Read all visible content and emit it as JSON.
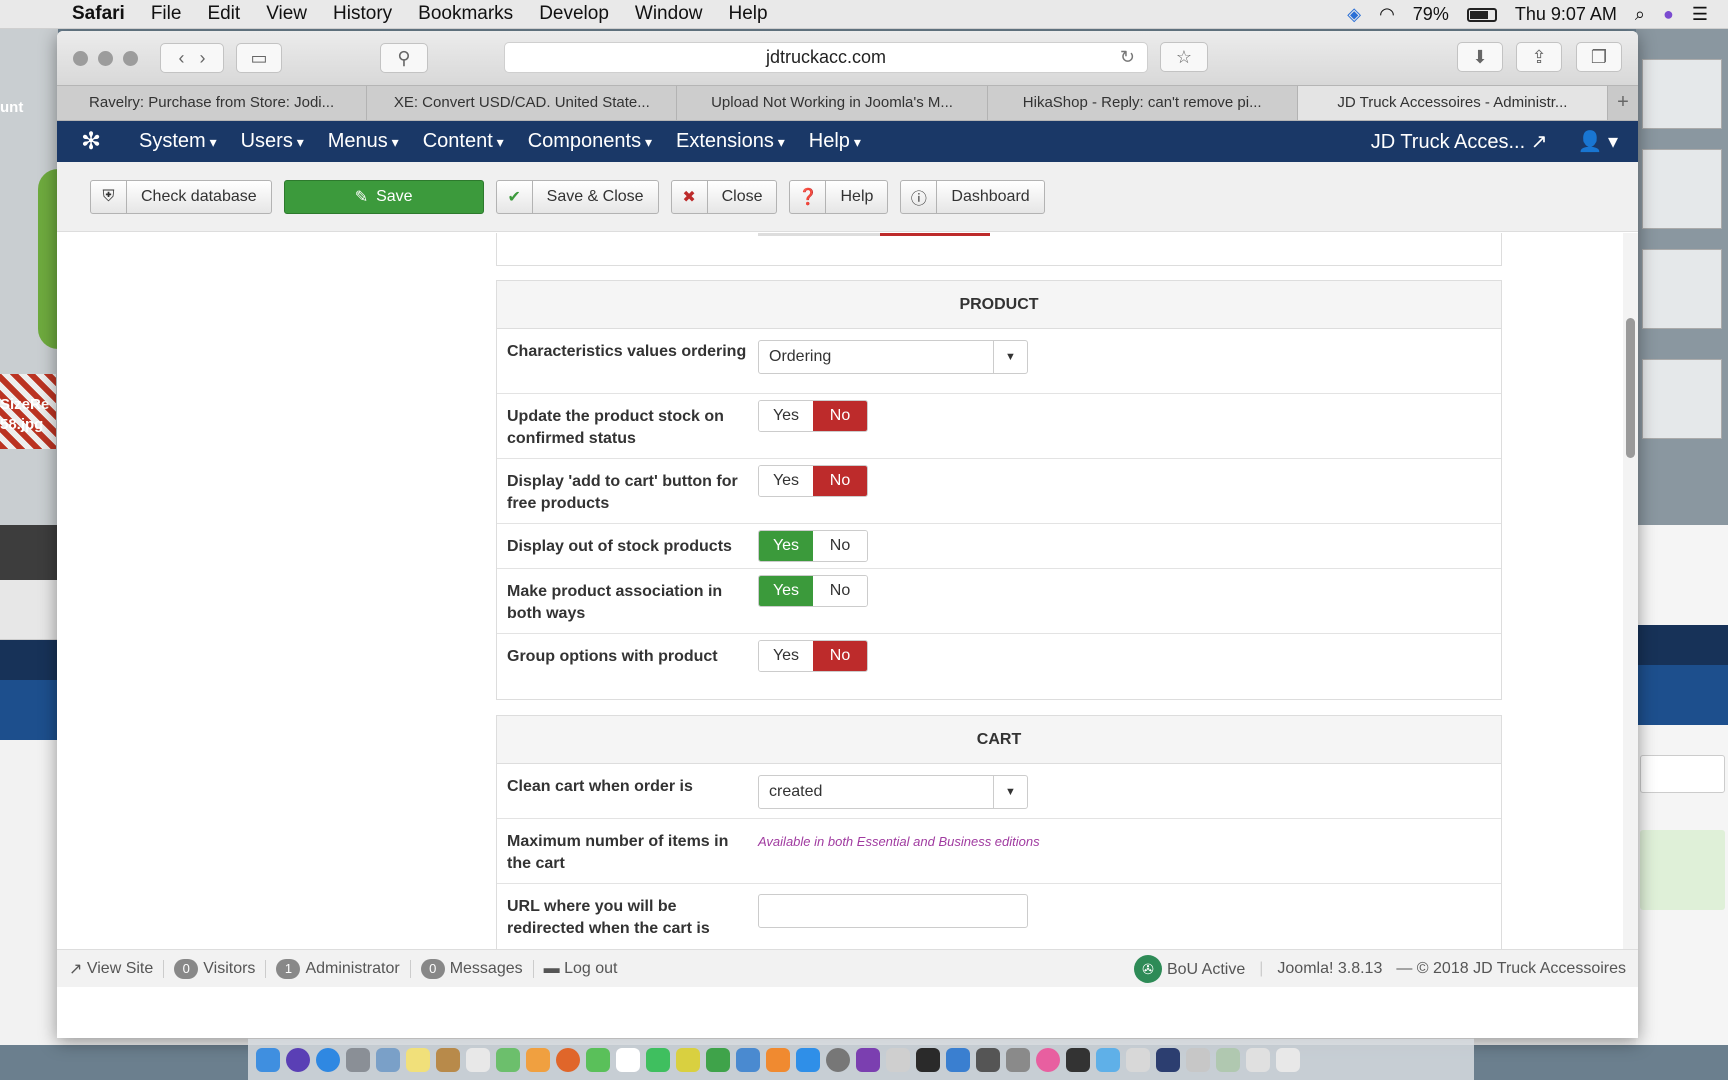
{
  "mac_menubar": {
    "app": "Safari",
    "items": [
      "File",
      "Edit",
      "View",
      "History",
      "Bookmarks",
      "Develop",
      "Window",
      "Help"
    ],
    "battery": "79%",
    "clock": "Thu 9:07 AM"
  },
  "desktop": {
    "labels": [
      "unt",
      "SizeRe",
      "58.jpg"
    ]
  },
  "browser": {
    "url": "jdtruckacc.com",
    "tabs": [
      "Ravelry: Purchase from Store: Jodi...",
      "XE: Convert USD/CAD. United State...",
      "Upload Not Working in Joomla's M...",
      "HikaShop - Reply: can't remove pi...",
      "JD Truck Accessoires - Administr..."
    ],
    "active_tab": 4
  },
  "joomla_nav": {
    "menus": [
      "System",
      "Users",
      "Menus",
      "Content",
      "Components",
      "Extensions",
      "Help"
    ],
    "site_name": "JD Truck Acces..."
  },
  "toolbar": {
    "check_database": "Check database",
    "save": "Save",
    "save_close": "Save & Close",
    "close": "Close",
    "help": "Help",
    "dashboard": "Dashboard"
  },
  "product_section": {
    "title": "PRODUCT",
    "yes_label": "Yes",
    "no_label": "No",
    "characteristics_label": "Characteristics values ordering",
    "characteristics_value": "Ordering",
    "rows": [
      {
        "label": "Update the product stock on confirmed status",
        "value": "No"
      },
      {
        "label": "Display 'add to cart' button for free products",
        "value": "No"
      },
      {
        "label": "Display out of stock products",
        "value": "Yes"
      },
      {
        "label": "Make product association in both ways",
        "value": "Yes"
      },
      {
        "label": "Group options with product",
        "value": "No"
      }
    ]
  },
  "cart_section": {
    "title": "CART",
    "clean_cart_label": "Clean cart when order is",
    "clean_cart_value": "created",
    "max_items_label": "Maximum number of items in the cart",
    "max_items_note": "Available in both Essential and Business editions",
    "redirect_label": "URL where you will be redirected when the cart is"
  },
  "statusbar": {
    "view_site": "View Site",
    "visitors_count": "0",
    "visitors": "Visitors",
    "admin_count": "1",
    "admin": "Administrator",
    "messages_count": "0",
    "messages": "Messages",
    "logout": "Log out",
    "bou": "BoU Active",
    "version": "Joomla! 3.8.13",
    "copyright": "— © 2018 JD Truck Accessoires"
  },
  "colors": {
    "joomla_nav": "#1a3867",
    "save_green": "#3c9a3c",
    "no_red": "#bd2b2b",
    "note_purple": "#a03ba0"
  }
}
